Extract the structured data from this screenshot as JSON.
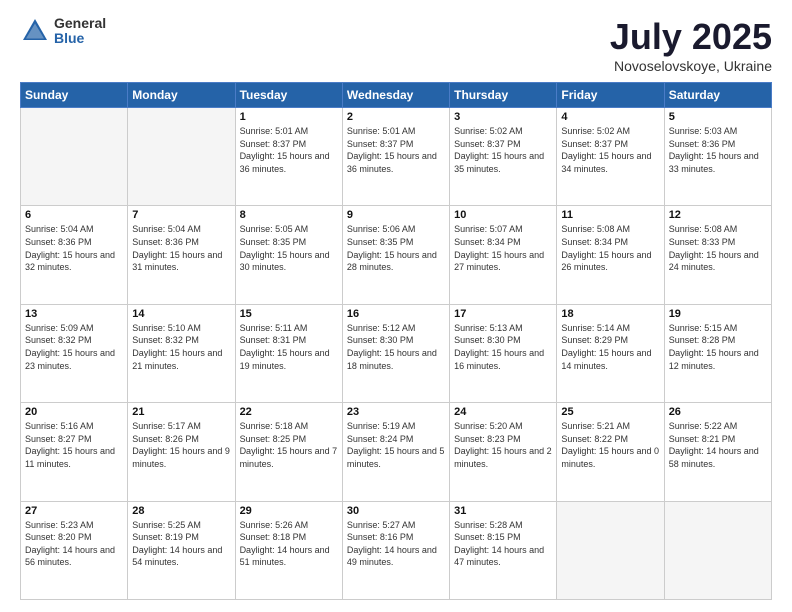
{
  "header": {
    "logo_general": "General",
    "logo_blue": "Blue",
    "month": "July 2025",
    "location": "Novoselovskoye, Ukraine"
  },
  "days_of_week": [
    "Sunday",
    "Monday",
    "Tuesday",
    "Wednesday",
    "Thursday",
    "Friday",
    "Saturday"
  ],
  "weeks": [
    [
      {
        "day": "",
        "info": ""
      },
      {
        "day": "",
        "info": ""
      },
      {
        "day": "1",
        "sunrise": "Sunrise: 5:01 AM",
        "sunset": "Sunset: 8:37 PM",
        "daylight": "Daylight: 15 hours and 36 minutes."
      },
      {
        "day": "2",
        "sunrise": "Sunrise: 5:01 AM",
        "sunset": "Sunset: 8:37 PM",
        "daylight": "Daylight: 15 hours and 36 minutes."
      },
      {
        "day": "3",
        "sunrise": "Sunrise: 5:02 AM",
        "sunset": "Sunset: 8:37 PM",
        "daylight": "Daylight: 15 hours and 35 minutes."
      },
      {
        "day": "4",
        "sunrise": "Sunrise: 5:02 AM",
        "sunset": "Sunset: 8:37 PM",
        "daylight": "Daylight: 15 hours and 34 minutes."
      },
      {
        "day": "5",
        "sunrise": "Sunrise: 5:03 AM",
        "sunset": "Sunset: 8:36 PM",
        "daylight": "Daylight: 15 hours and 33 minutes."
      }
    ],
    [
      {
        "day": "6",
        "sunrise": "Sunrise: 5:04 AM",
        "sunset": "Sunset: 8:36 PM",
        "daylight": "Daylight: 15 hours and 32 minutes."
      },
      {
        "day": "7",
        "sunrise": "Sunrise: 5:04 AM",
        "sunset": "Sunset: 8:36 PM",
        "daylight": "Daylight: 15 hours and 31 minutes."
      },
      {
        "day": "8",
        "sunrise": "Sunrise: 5:05 AM",
        "sunset": "Sunset: 8:35 PM",
        "daylight": "Daylight: 15 hours and 30 minutes."
      },
      {
        "day": "9",
        "sunrise": "Sunrise: 5:06 AM",
        "sunset": "Sunset: 8:35 PM",
        "daylight": "Daylight: 15 hours and 28 minutes."
      },
      {
        "day": "10",
        "sunrise": "Sunrise: 5:07 AM",
        "sunset": "Sunset: 8:34 PM",
        "daylight": "Daylight: 15 hours and 27 minutes."
      },
      {
        "day": "11",
        "sunrise": "Sunrise: 5:08 AM",
        "sunset": "Sunset: 8:34 PM",
        "daylight": "Daylight: 15 hours and 26 minutes."
      },
      {
        "day": "12",
        "sunrise": "Sunrise: 5:08 AM",
        "sunset": "Sunset: 8:33 PM",
        "daylight": "Daylight: 15 hours and 24 minutes."
      }
    ],
    [
      {
        "day": "13",
        "sunrise": "Sunrise: 5:09 AM",
        "sunset": "Sunset: 8:32 PM",
        "daylight": "Daylight: 15 hours and 23 minutes."
      },
      {
        "day": "14",
        "sunrise": "Sunrise: 5:10 AM",
        "sunset": "Sunset: 8:32 PM",
        "daylight": "Daylight: 15 hours and 21 minutes."
      },
      {
        "day": "15",
        "sunrise": "Sunrise: 5:11 AM",
        "sunset": "Sunset: 8:31 PM",
        "daylight": "Daylight: 15 hours and 19 minutes."
      },
      {
        "day": "16",
        "sunrise": "Sunrise: 5:12 AM",
        "sunset": "Sunset: 8:30 PM",
        "daylight": "Daylight: 15 hours and 18 minutes."
      },
      {
        "day": "17",
        "sunrise": "Sunrise: 5:13 AM",
        "sunset": "Sunset: 8:30 PM",
        "daylight": "Daylight: 15 hours and 16 minutes."
      },
      {
        "day": "18",
        "sunrise": "Sunrise: 5:14 AM",
        "sunset": "Sunset: 8:29 PM",
        "daylight": "Daylight: 15 hours and 14 minutes."
      },
      {
        "day": "19",
        "sunrise": "Sunrise: 5:15 AM",
        "sunset": "Sunset: 8:28 PM",
        "daylight": "Daylight: 15 hours and 12 minutes."
      }
    ],
    [
      {
        "day": "20",
        "sunrise": "Sunrise: 5:16 AM",
        "sunset": "Sunset: 8:27 PM",
        "daylight": "Daylight: 15 hours and 11 minutes."
      },
      {
        "day": "21",
        "sunrise": "Sunrise: 5:17 AM",
        "sunset": "Sunset: 8:26 PM",
        "daylight": "Daylight: 15 hours and 9 minutes."
      },
      {
        "day": "22",
        "sunrise": "Sunrise: 5:18 AM",
        "sunset": "Sunset: 8:25 PM",
        "daylight": "Daylight: 15 hours and 7 minutes."
      },
      {
        "day": "23",
        "sunrise": "Sunrise: 5:19 AM",
        "sunset": "Sunset: 8:24 PM",
        "daylight": "Daylight: 15 hours and 5 minutes."
      },
      {
        "day": "24",
        "sunrise": "Sunrise: 5:20 AM",
        "sunset": "Sunset: 8:23 PM",
        "daylight": "Daylight: 15 hours and 2 minutes."
      },
      {
        "day": "25",
        "sunrise": "Sunrise: 5:21 AM",
        "sunset": "Sunset: 8:22 PM",
        "daylight": "Daylight: 15 hours and 0 minutes."
      },
      {
        "day": "26",
        "sunrise": "Sunrise: 5:22 AM",
        "sunset": "Sunset: 8:21 PM",
        "daylight": "Daylight: 14 hours and 58 minutes."
      }
    ],
    [
      {
        "day": "27",
        "sunrise": "Sunrise: 5:23 AM",
        "sunset": "Sunset: 8:20 PM",
        "daylight": "Daylight: 14 hours and 56 minutes."
      },
      {
        "day": "28",
        "sunrise": "Sunrise: 5:25 AM",
        "sunset": "Sunset: 8:19 PM",
        "daylight": "Daylight: 14 hours and 54 minutes."
      },
      {
        "day": "29",
        "sunrise": "Sunrise: 5:26 AM",
        "sunset": "Sunset: 8:18 PM",
        "daylight": "Daylight: 14 hours and 51 minutes."
      },
      {
        "day": "30",
        "sunrise": "Sunrise: 5:27 AM",
        "sunset": "Sunset: 8:16 PM",
        "daylight": "Daylight: 14 hours and 49 minutes."
      },
      {
        "day": "31",
        "sunrise": "Sunrise: 5:28 AM",
        "sunset": "Sunset: 8:15 PM",
        "daylight": "Daylight: 14 hours and 47 minutes."
      },
      {
        "day": "",
        "info": ""
      },
      {
        "day": "",
        "info": ""
      }
    ]
  ]
}
